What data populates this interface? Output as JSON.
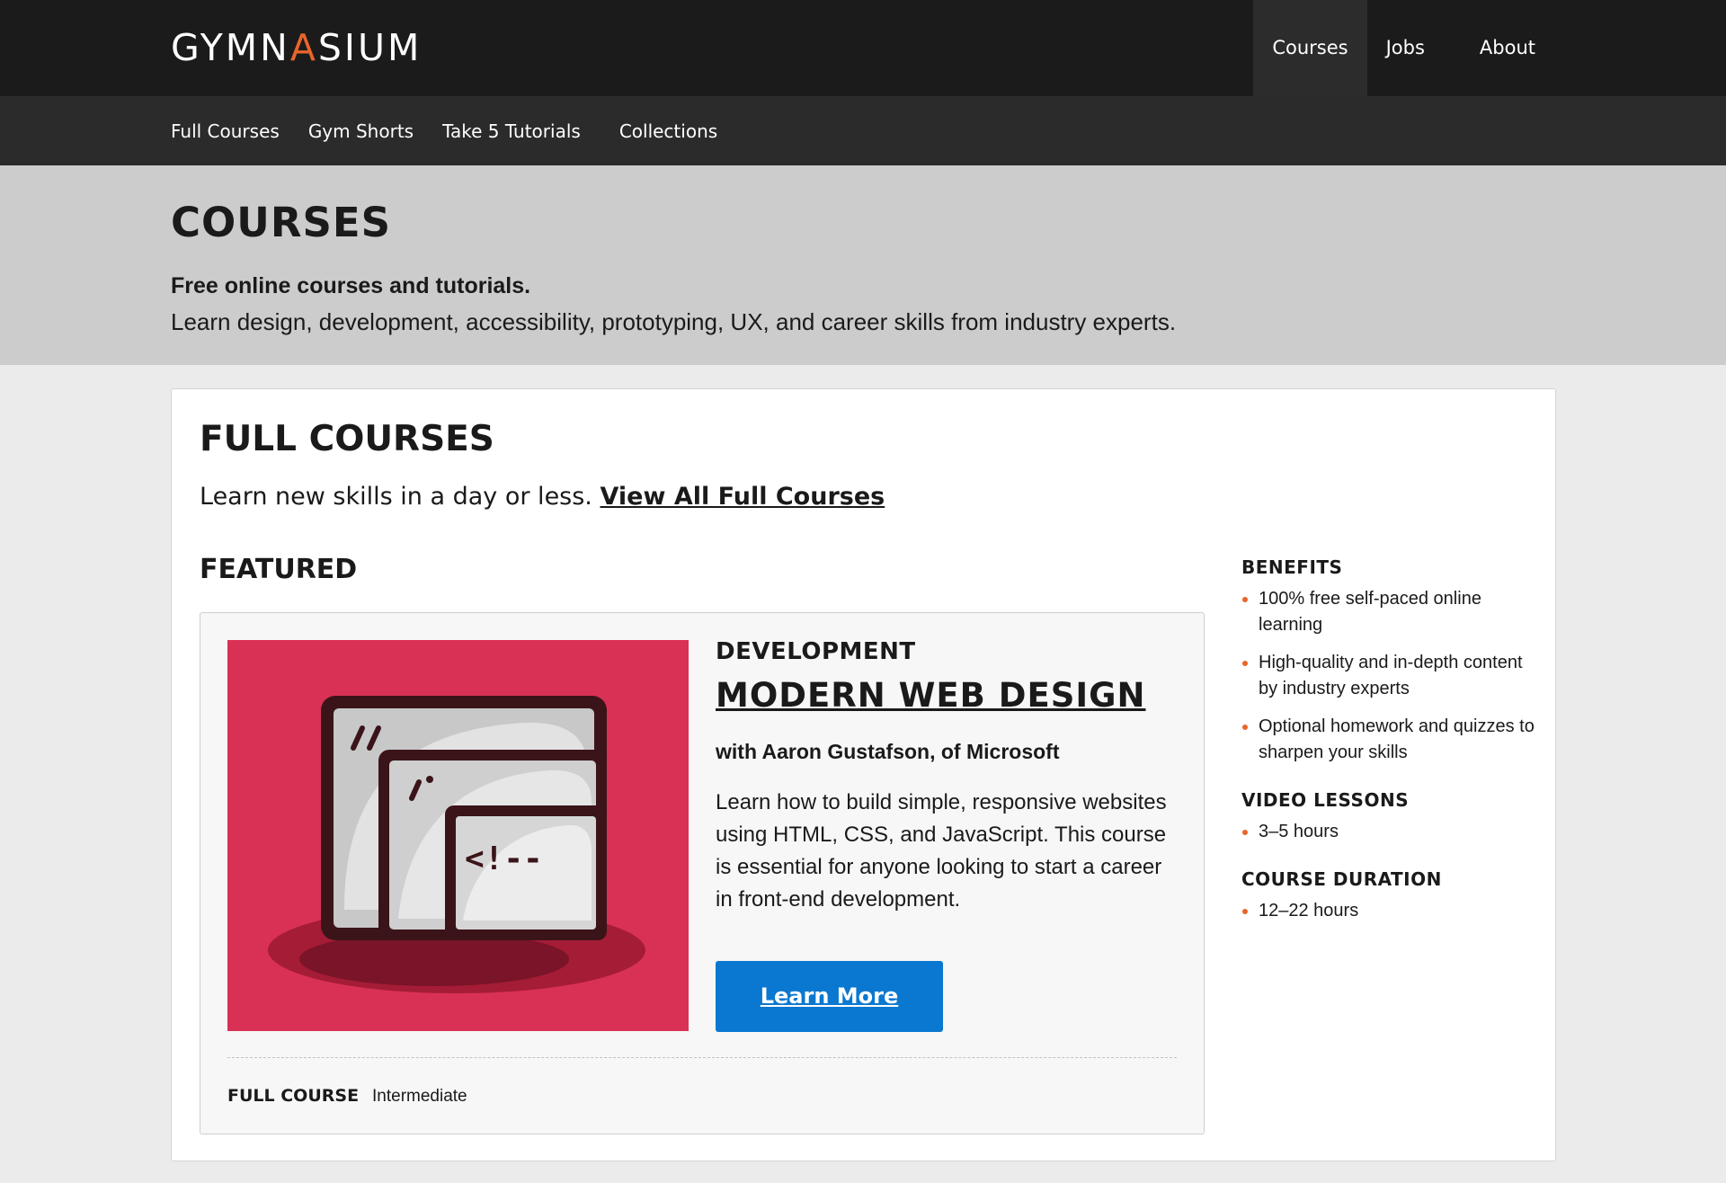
{
  "brand": {
    "logo_prefix": "GYMN",
    "logo_accent": "A",
    "logo_suffix": "SIUM",
    "accent_color": "#e8652b"
  },
  "main_nav": {
    "courses": "Courses",
    "jobs": "Jobs",
    "about": "About"
  },
  "sub_nav": {
    "full_courses": "Full Courses",
    "gym_shorts": "Gym Shorts",
    "take5": "Take 5 Tutorials",
    "collections": "Collections"
  },
  "hero": {
    "title": "COURSES",
    "lead": "Free online courses and tutorials.",
    "subtitle": "Learn design, development, accessibility, prototyping, UX, and career skills from industry experts."
  },
  "full_courses": {
    "title": "FULL COURSES",
    "intro_text": "Learn new skills in a day or less. ",
    "view_all_link": "View All Full Courses",
    "featured_heading": "FEATURED"
  },
  "featured_course": {
    "category": "DEVELOPMENT",
    "title": "MODERN WEB DESIGN",
    "author": "with Aaron Gustafson, of Microsoft",
    "description": "Learn how to build simple, responsive websites using HTML, CSS, and JavaScript. This course is essential for anyone looking to start a career in front-end development.",
    "button_label": "Learn More",
    "button_color": "#0a78d0",
    "thumbnail_color": "#d93156",
    "meta_type": "FULL COURSE",
    "meta_level": "Intermediate"
  },
  "sidebar": {
    "benefits_heading": "BENEFITS",
    "benefits": [
      "100% free self-paced online learning",
      "High-quality and in-depth content by industry experts",
      "Optional homework and quizzes to sharpen your skills"
    ],
    "video_heading": "VIDEO LESSONS",
    "video_value": "3–5 hours",
    "duration_heading": "COURSE DURATION",
    "duration_value": "12–22 hours"
  }
}
